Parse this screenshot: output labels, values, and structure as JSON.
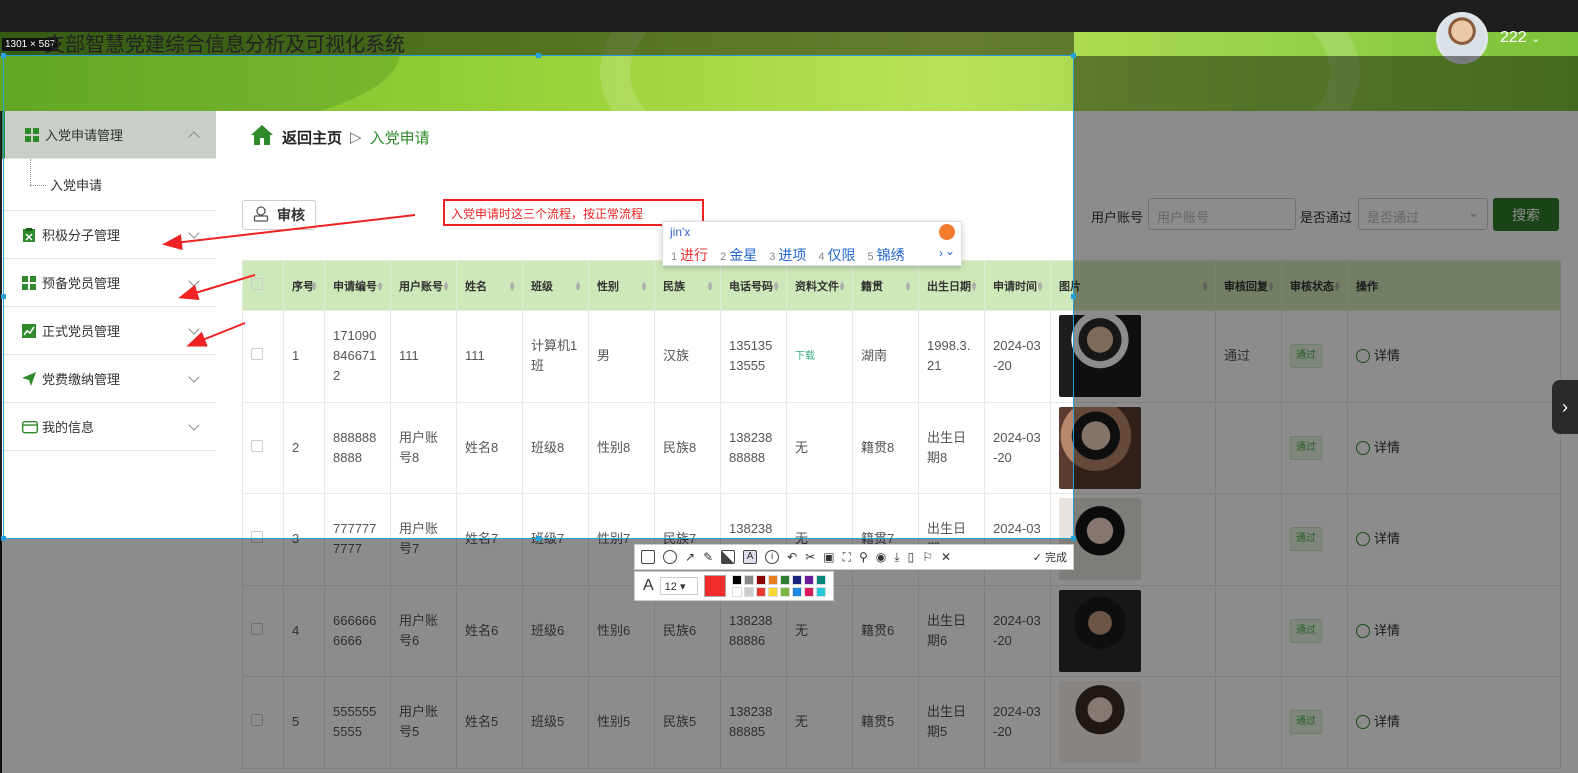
{
  "app": {
    "title": "支部智慧党建综合信息分析及可视化系统",
    "user": "222"
  },
  "screenshot_tool": {
    "dimensions": "1301 × 587",
    "annotation": "入党申请时这三个流程，按正常流程",
    "done_label": "完成",
    "font_size": "12"
  },
  "ime": {
    "pinyin": "jin'x",
    "candidates": [
      {
        "n": "1",
        "t": "进行"
      },
      {
        "n": "2",
        "t": "金星"
      },
      {
        "n": "3",
        "t": "进项"
      },
      {
        "n": "4",
        "t": "仅限"
      },
      {
        "n": "5",
        "t": "锦绣"
      }
    ]
  },
  "sidebar": {
    "items": [
      {
        "label": "入党申请管理",
        "icon": "grid-icon",
        "expanded": true,
        "sub": [
          "入党申请"
        ]
      },
      {
        "label": "积极分子管理",
        "icon": "clipboard-icon"
      },
      {
        "label": "预备党员管理",
        "icon": "grid-icon"
      },
      {
        "label": "正式党员管理",
        "icon": "chart-icon"
      },
      {
        "label": "党费缴纳管理",
        "icon": "send-icon"
      },
      {
        "label": "我的信息",
        "icon": "card-icon"
      }
    ]
  },
  "breadcrumb": {
    "home": "返回主页",
    "separator": "▷",
    "current": "入党申请"
  },
  "toolbar": {
    "review": "审核"
  },
  "filters": {
    "account_label": "用户账号",
    "account_placeholder": "用户账号",
    "passed_label": "是否通过",
    "passed_placeholder": "是否通过",
    "search": "搜索"
  },
  "table": {
    "columns": [
      "",
      "序号",
      "申请编号",
      "用户账号",
      "姓名",
      "班级",
      "性别",
      "民族",
      "电话号码",
      "资料文件",
      "籍贯",
      "出生日期",
      "申请时间",
      "图片",
      "审核回复",
      "审核状态",
      "操作"
    ],
    "rows": [
      {
        "no": "1",
        "code": "1710908466712",
        "account": "111",
        "name": "111",
        "class": "计算机1班",
        "gender": "男",
        "ethnic": "汉族",
        "phone": "13513513555",
        "file": "下载",
        "origin": "湖南",
        "birth": "1998.3.21",
        "time": "2024-03-20",
        "reply": "通过",
        "status": "通过",
        "action": "详情"
      },
      {
        "no": "2",
        "code": "8888888888",
        "account": "用户账号8",
        "name": "姓名8",
        "class": "班级8",
        "gender": "性别8",
        "ethnic": "民族8",
        "phone": "13823888888",
        "file": "无",
        "origin": "籍贯8",
        "birth": "出生日期8",
        "time": "2024-03-20",
        "reply": "",
        "status": "通过",
        "action": "详情"
      },
      {
        "no": "3",
        "code": "7777777777",
        "account": "用户账号7",
        "name": "姓名7",
        "class": "班级7",
        "gender": "性别7",
        "ethnic": "民族7",
        "phone": "13823887887",
        "file": "无",
        "origin": "籍贯7",
        "birth": "出生日期7",
        "time": "2024-03-20",
        "reply": "",
        "status": "通过",
        "action": "详情"
      },
      {
        "no": "4",
        "code": "6666666666",
        "account": "用户账号6",
        "name": "姓名6",
        "class": "班级6",
        "gender": "性别6",
        "ethnic": "民族6",
        "phone": "13823888886",
        "file": "无",
        "origin": "籍贯6",
        "birth": "出生日期6",
        "time": "2024-03-20",
        "reply": "",
        "status": "通过",
        "action": "详情"
      },
      {
        "no": "5",
        "code": "5555555555",
        "account": "用户账号5",
        "name": "姓名5",
        "class": "班级5",
        "gender": "性别5",
        "ethnic": "民族5",
        "phone": "13823888885",
        "file": "无",
        "origin": "籍贯5",
        "birth": "出生日期5",
        "time": "2024-03-20",
        "reply": "",
        "status": "通过",
        "action": "详情"
      }
    ]
  },
  "colors": {
    "brand": "#2f8a2b",
    "annotation": "#e22222",
    "selection": "#27a0d8"
  }
}
